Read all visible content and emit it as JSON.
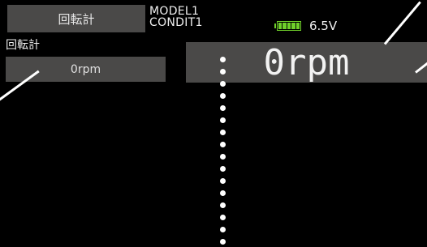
{
  "header": {
    "screen_title": "回転計",
    "model": "MODEL1",
    "condition": "CONDIT1",
    "battery": {
      "voltage": "6.5V",
      "color": "#6fcf2a",
      "level": 1.0
    }
  },
  "tachometer": {
    "label": "回転計",
    "small_value": "0rpm",
    "large_value": "0rpm"
  }
}
